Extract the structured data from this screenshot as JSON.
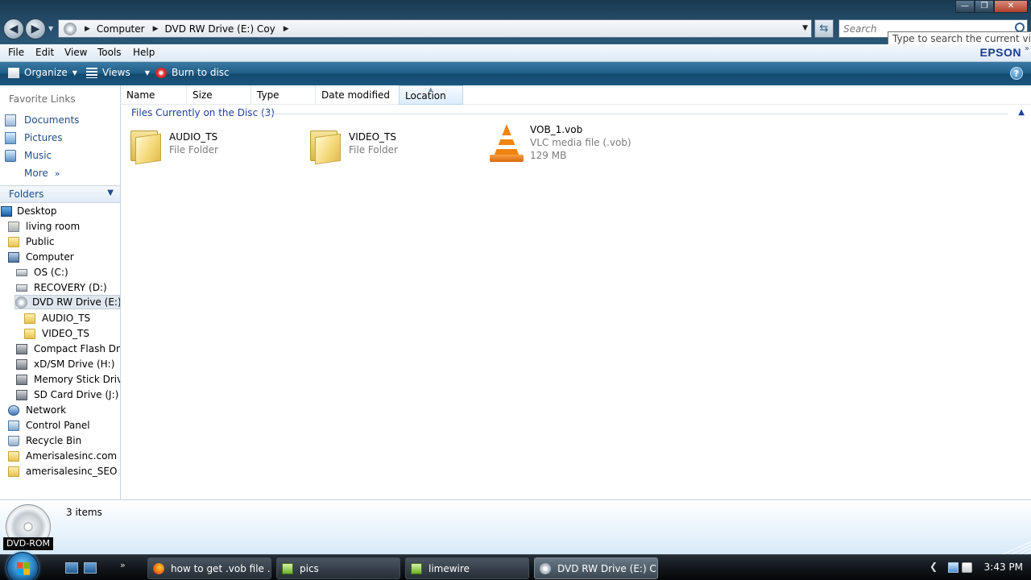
{
  "window": {
    "address": {
      "crumbs": [
        "Computer",
        "DVD RW Drive (E:) Coy"
      ]
    },
    "search": {
      "placeholder": "Search"
    },
    "tooltip": "Type to search the current view"
  },
  "menu": {
    "items": [
      "File",
      "Edit",
      "View",
      "Tools",
      "Help"
    ],
    "brand": "EPSON"
  },
  "toolbar": {
    "organize": "Organize",
    "views": "Views",
    "burn": "Burn to disc"
  },
  "nav": {
    "favorites_header": "Favorite Links",
    "favorites": [
      "Documents",
      "Pictures",
      "Music"
    ],
    "more": "More",
    "folders_label": "Folders",
    "tree": [
      {
        "label": "Desktop",
        "icon": "desktop-icon"
      },
      {
        "label": "living room",
        "icon": "user-icon"
      },
      {
        "label": "Public",
        "icon": "folder-icon"
      },
      {
        "label": "Computer",
        "icon": "computer-icon"
      },
      {
        "label": "OS (C:)",
        "icon": "drive-icon"
      },
      {
        "label": "RECOVERY (D:)",
        "icon": "drive-icon"
      },
      {
        "label": "DVD RW Drive (E:) C",
        "icon": "dvd-icon"
      },
      {
        "label": "AUDIO_TS",
        "icon": "folder-icon"
      },
      {
        "label": "VIDEO_TS",
        "icon": "folder-icon"
      },
      {
        "label": "Compact Flash Drive",
        "icon": "card-drive-icon"
      },
      {
        "label": "xD/SM Drive (H:)",
        "icon": "card-drive-icon"
      },
      {
        "label": "Memory Stick Drive",
        "icon": "card-drive-icon"
      },
      {
        "label": "SD Card Drive (J:)",
        "icon": "card-drive-icon"
      },
      {
        "label": "Network",
        "icon": "network-icon"
      },
      {
        "label": "Control Panel",
        "icon": "control-panel-icon"
      },
      {
        "label": "Recycle Bin",
        "icon": "recycle-bin-icon"
      },
      {
        "label": "Amerisalesinc.com",
        "icon": "folder-icon"
      },
      {
        "label": "amerisalesinc_SEO",
        "icon": "folder-icon"
      }
    ]
  },
  "columns": [
    "Name",
    "Size",
    "Type",
    "Date modified",
    "Location"
  ],
  "group": {
    "title": "Files Currently on the Disc (3)"
  },
  "files": [
    {
      "name": "AUDIO_TS",
      "type": "File Folder"
    },
    {
      "name": "VIDEO_TS",
      "type": "File Folder"
    },
    {
      "name": "VOB_1.vob",
      "type": "VLC media file (.vob)",
      "size": "129 MB"
    }
  ],
  "details": {
    "drive_label": "DVD-ROM",
    "count": "3 items"
  },
  "taskbar": {
    "tasks": [
      {
        "label": "how to get .vob file ...",
        "icon": "firefox-icon"
      },
      {
        "label": "pics",
        "icon": "folder-icon"
      },
      {
        "label": "limewire",
        "icon": "folder-icon"
      },
      {
        "label": "DVD RW Drive (E:) C...",
        "icon": "dvd-icon"
      }
    ],
    "clock": "3:43 PM"
  },
  "colors": {
    "link_blue": "#1f4d8a",
    "group_blue": "#1e3fa0",
    "toolbar_blue": "#1f5d86"
  }
}
